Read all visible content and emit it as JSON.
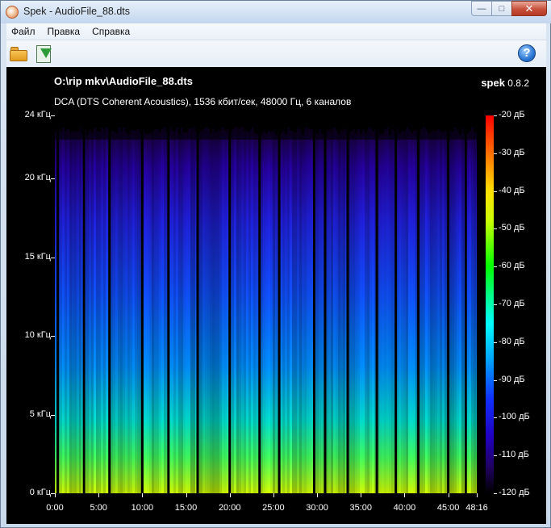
{
  "window": {
    "title": "Spek - AudioFile_88.dts",
    "minimize_label": "—",
    "maximize_label": "□",
    "close_label": "✕"
  },
  "menu": {
    "items": [
      "Файл",
      "Правка",
      "Справка"
    ]
  },
  "toolbar": {
    "open_icon": "folder-open-icon",
    "save_icon": "save-image-icon",
    "help_icon": "help-icon",
    "help_glyph": "?"
  },
  "spectrogram": {
    "file_path": "O:\\rip mkv\\AudioFile_88.dts",
    "file_info": "DCA (DTS Coherent Acoustics), 1536 кбит/сек, 48000 Гц, 6 каналов",
    "brand_name": "spek",
    "brand_version": "0.8.2",
    "y_ticks": [
      "24 кГц",
      "20 кГц",
      "15 кГц",
      "10 кГц",
      "5 кГц",
      "0 кГц"
    ],
    "y_values_khz": [
      24,
      20,
      15,
      10,
      5,
      0
    ],
    "x_ticks": [
      "0:00",
      "5:00",
      "10:00",
      "15:00",
      "20:00",
      "25:00",
      "30:00",
      "35:00",
      "40:00",
      "45:00",
      "48:16"
    ],
    "x_values_sec": [
      0,
      300,
      600,
      900,
      1200,
      1500,
      1800,
      2100,
      2400,
      2700,
      2896
    ],
    "db_ticks": [
      "-20 дБ",
      "-30 дБ",
      "-40 дБ",
      "-50 дБ",
      "-60 дБ",
      "-70 дБ",
      "-80 дБ",
      "-90 дБ",
      "-100 дБ",
      "-110 дБ",
      "-120 дБ"
    ],
    "db_values": [
      -20,
      -30,
      -40,
      -50,
      -60,
      -70,
      -80,
      -90,
      -100,
      -110,
      -120
    ],
    "gap_times_sec": [
      20,
      200,
      375,
      600,
      780,
      980,
      1200,
      1405,
      1540,
      1780,
      1855,
      2010,
      2210,
      2340,
      2495,
      2700,
      2820
    ],
    "colors": {
      "background": "#000000",
      "high_energy": "#c8ff00",
      "mid_energy": "#00ffd0",
      "low_energy": "#1030ff",
      "silence": "#200050"
    }
  }
}
